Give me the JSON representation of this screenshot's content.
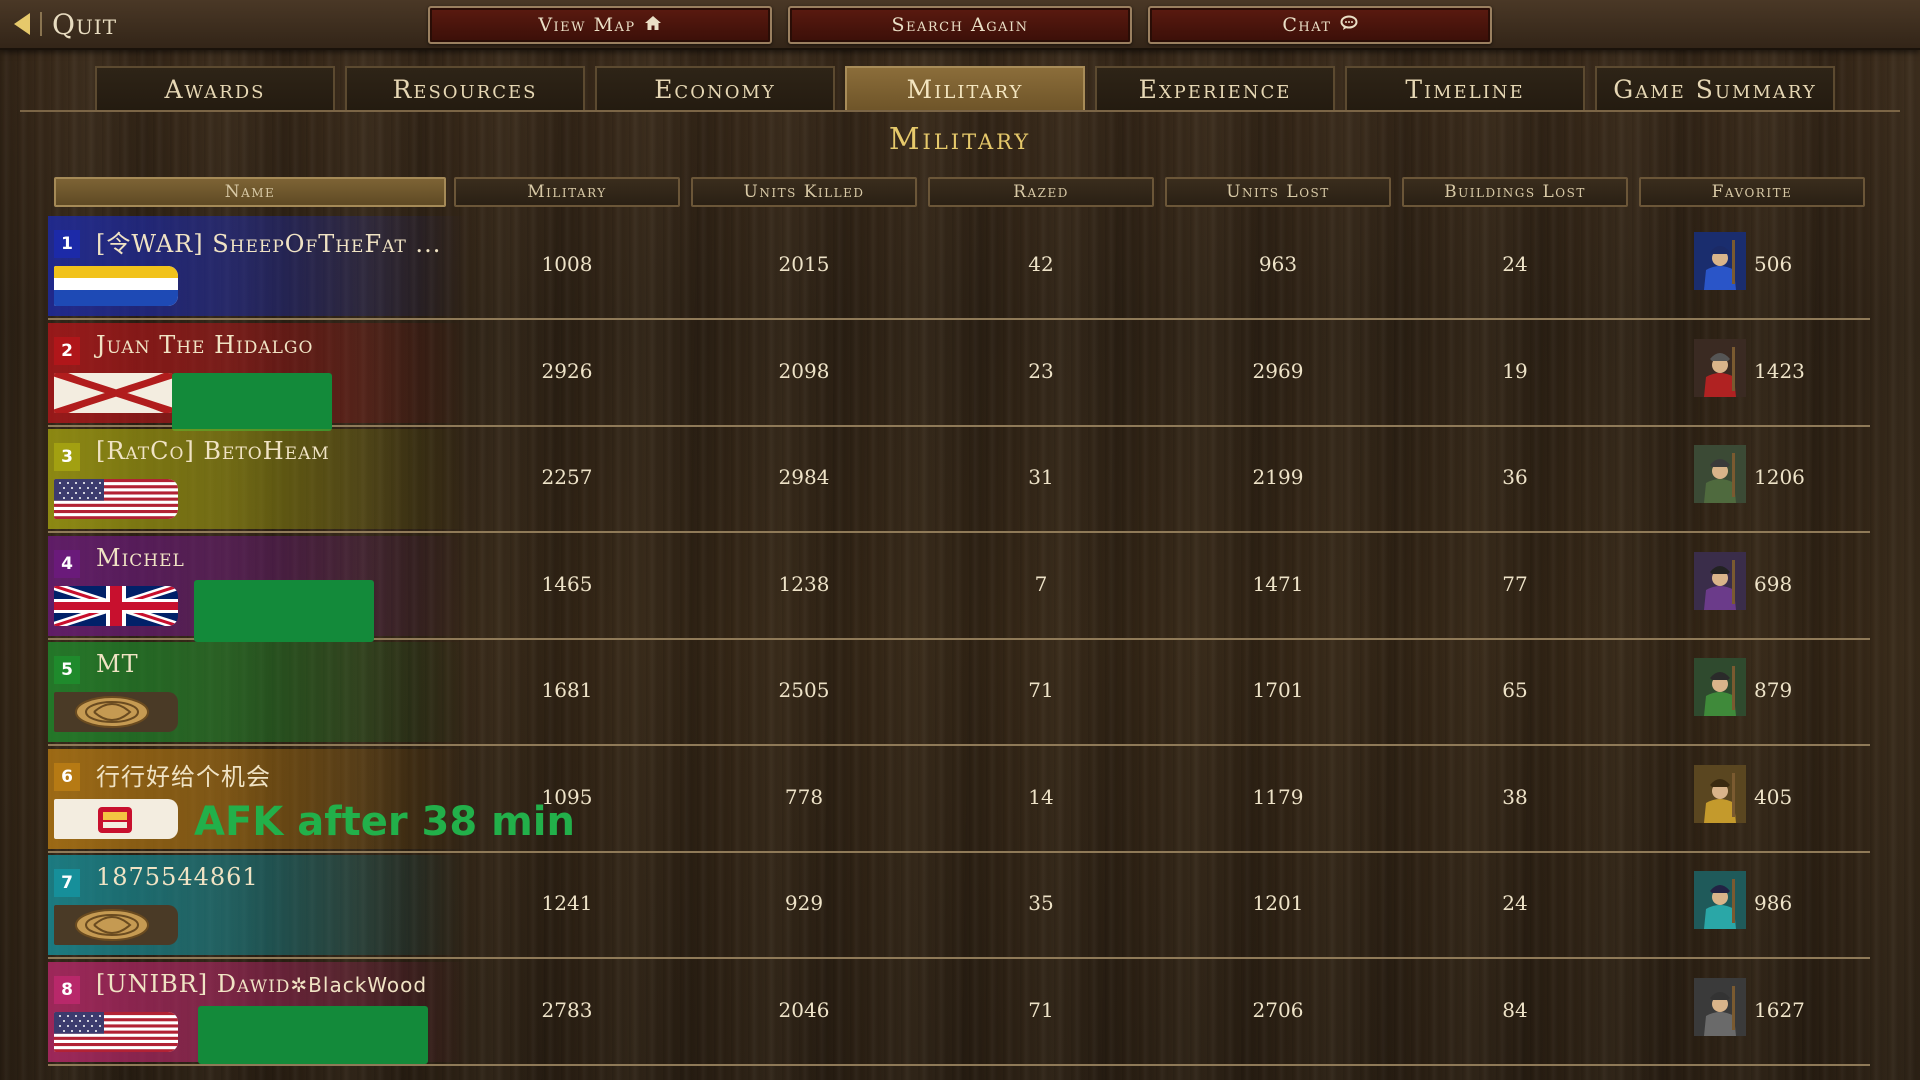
{
  "topbar": {
    "quit_label": "Quit",
    "view_map_label": "View Map",
    "search_again_label": "Search Again",
    "chat_label": "Chat"
  },
  "tabs": [
    {
      "label": "Awards"
    },
    {
      "label": "Resources"
    },
    {
      "label": "Economy"
    },
    {
      "label": "Military",
      "active": true
    },
    {
      "label": "Experience"
    },
    {
      "label": "Timeline"
    },
    {
      "label": "Game Summary"
    }
  ],
  "page_title": "Military",
  "columns": [
    "Name",
    "Military",
    "Units Killed",
    "Razed",
    "Units Lost",
    "Buildings Lost",
    "Favorite"
  ],
  "players": [
    {
      "rank": "1",
      "name": "[令WAR] SheepOfTheFat ...",
      "color": "#1c2aa8",
      "flag": "flag-yellow-blue",
      "military": "1008",
      "units_killed": "2015",
      "razed": "42",
      "units_lost": "963",
      "buildings_lost": "24",
      "favorite_count": "506",
      "favorite_icon": "musketeer-blue-icon"
    },
    {
      "rank": "2",
      "name": "Juan The Hidalgo",
      "color": "#b0161a",
      "flag": "flag-burgundy-cross",
      "military": "2926",
      "units_killed": "2098",
      "razed": "23",
      "units_lost": "2969",
      "buildings_lost": "19",
      "favorite_count": "1423",
      "favorite_icon": "rodelero-icon"
    },
    {
      "rank": "3",
      "name": "[RatCo] BetoHeam",
      "color": "#a2a011",
      "flag": "flag-usa",
      "military": "2257",
      "units_killed": "2984",
      "razed": "31",
      "units_lost": "2199",
      "buildings_lost": "36",
      "favorite_count": "1206",
      "favorite_icon": "regular-icon"
    },
    {
      "rank": "4",
      "name": "Michel",
      "color": "#6a1a7a",
      "flag": "flag-uk",
      "military": "1465",
      "units_killed": "1238",
      "razed": "7",
      "units_lost": "1471",
      "buildings_lost": "77",
      "favorite_count": "698",
      "favorite_icon": "officer-icon"
    },
    {
      "rank": "5",
      "name": "MT",
      "color": "#1f8a2c",
      "flag": "flag-emblem-gold",
      "military": "1681",
      "units_killed": "2505",
      "razed": "71",
      "units_lost": "1701",
      "buildings_lost": "65",
      "favorite_count": "879",
      "favorite_icon": "ninja-icon"
    },
    {
      "rank": "6",
      "name": "行行好给个机会",
      "color": "#b67a14",
      "flag": "flag-hongkong-arms",
      "note": "AFK after 38 min",
      "military": "1095",
      "units_killed": "778",
      "razed": "14",
      "units_lost": "1179",
      "buildings_lost": "38",
      "favorite_count": "405",
      "favorite_icon": "hussar-icon"
    },
    {
      "rank": "7",
      "name": "1875544861",
      "color": "#168f9a",
      "flag": "flag-emblem-gold",
      "military": "1241",
      "units_killed": "929",
      "razed": "35",
      "units_lost": "1201",
      "buildings_lost": "24",
      "favorite_count": "986",
      "favorite_icon": "samurai-teal-icon"
    },
    {
      "rank": "8",
      "name": "[UNIBR] Dawid",
      "name_suffix": "✲BlackWood",
      "color": "#b8286a",
      "flag": "flag-usa",
      "military": "2783",
      "units_killed": "2046",
      "razed": "71",
      "units_lost": "2706",
      "buildings_lost": "84",
      "favorite_count": "1627",
      "favorite_icon": "pikeman-icon"
    }
  ],
  "icons": {
    "quit": "back-arrow-icon",
    "view_map": "home-icon",
    "chat": "speech-bubble-icon"
  }
}
